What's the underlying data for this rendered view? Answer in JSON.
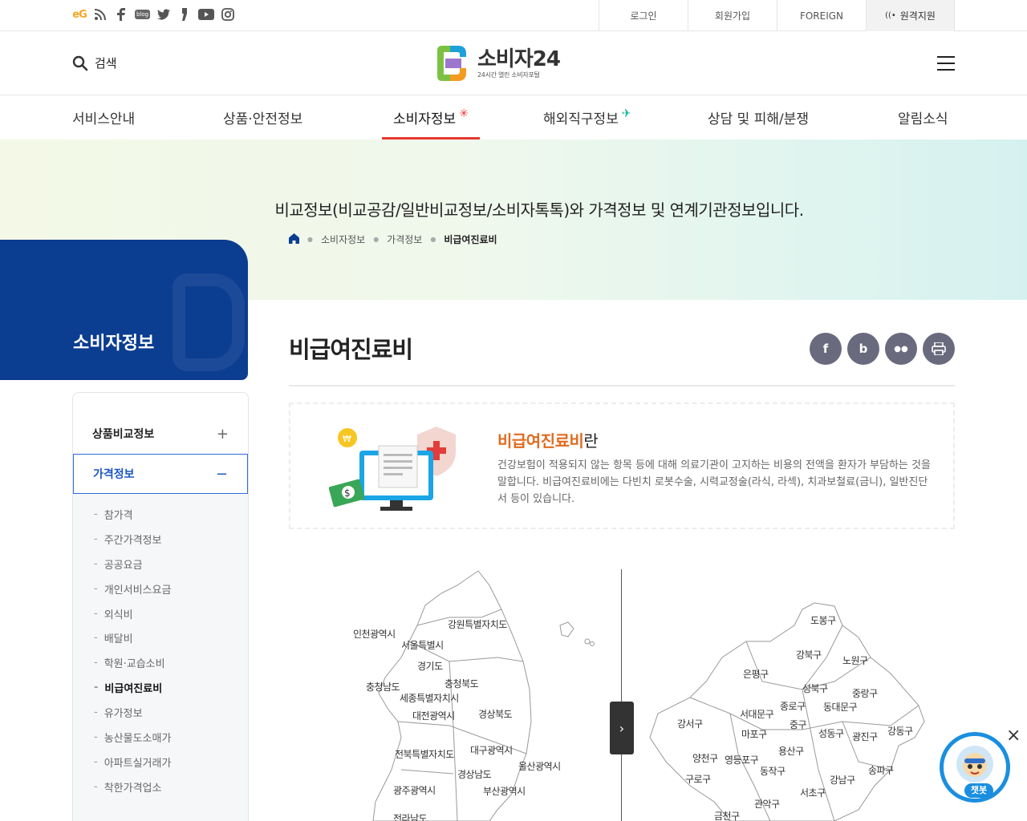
{
  "topbar": {
    "sns_icons": [
      "eg-logo-icon",
      "rss-icon",
      "facebook-icon",
      "blog-icon",
      "twitter-icon",
      "story-icon",
      "youtube-icon",
      "instagram-icon"
    ],
    "eg_label": "eG",
    "blog_label": "blog",
    "links": {
      "login": "로그인",
      "join": "회원가입",
      "foreign": "FOREIGN",
      "remote": "원격지원"
    }
  },
  "header": {
    "search_label": "검색",
    "logo_title": "소비자24",
    "logo_sub": "24시간 열린 소비자포털"
  },
  "gnb": {
    "items": [
      "서비스안내",
      "상품·안전정보",
      "소비자정보",
      "해외직구정보",
      "상담 및 피해/분쟁",
      "알림소식"
    ],
    "active_index": 2
  },
  "hero": {
    "description": "비교정보(비교공감/일반비교정보/소비자톡톡)와 가격정보 및 연계기관정보입니다.",
    "breadcrumb": [
      "소비자정보",
      "가격정보",
      "비급여진료비"
    ]
  },
  "side": {
    "title": "소비자정보",
    "groups": [
      {
        "label": "상품비교정보",
        "sign": "+"
      },
      {
        "label": "가격정보",
        "sign": "−"
      }
    ],
    "sub_items": [
      "참가격",
      "주간가격정보",
      "공공요금",
      "개인서비스요금",
      "외식비",
      "배달비",
      "학원·교습소비",
      "비급여진료비",
      "유가정보",
      "농산물도소매가",
      "아파트실거래가",
      "착한가격업소"
    ],
    "active_sub": "비급여진료비"
  },
  "content": {
    "page_title": "비급여진료비",
    "share_icons": [
      "facebook-share-icon",
      "band-share-icon",
      "talk-share-icon",
      "print-icon"
    ],
    "info_head": "비급여진료비",
    "info_head_suffix": "란",
    "info_body": "건강보험이 적용되지 않는 항목 등에 대해 의료기관이 고지하는 비용의 전액을 환자가 부담하는 것을 말합니다. 비급여진료비에는 다빈치 로봇수술, 시력교정술(라식, 라섹), 치과보철료(금니), 일반진단서 등이 있습니다."
  },
  "map_korea": [
    "인천광역시",
    "서울특별시",
    "강원특별자치도",
    "경기도",
    "충청남도",
    "충청북도",
    "세종특별자치시",
    "대전광역시",
    "경상북도",
    "전북특별자치도",
    "대구광역시",
    "울산광역시",
    "경상남도",
    "광주광역시",
    "부산광역시",
    "전라남도"
  ],
  "map_seoul": [
    "도봉구",
    "강북구",
    "노원구",
    "은평구",
    "성북구",
    "중랑구",
    "서대문구",
    "종로구",
    "동대문구",
    "강서구",
    "마포구",
    "중구",
    "성동구",
    "광진구",
    "강동구",
    "양천구",
    "영등포구",
    "용산구",
    "구로구",
    "동작구",
    "강남구",
    "송파구",
    "서초구",
    "관악구",
    "금천구"
  ],
  "chatbot": {
    "label": "챗봇"
  },
  "colors": {
    "primary_navy": "#0b3d91",
    "accent_red": "#e8382f",
    "accent_orange": "#e06b1f",
    "chatbot_blue": "#1a8fe0"
  }
}
